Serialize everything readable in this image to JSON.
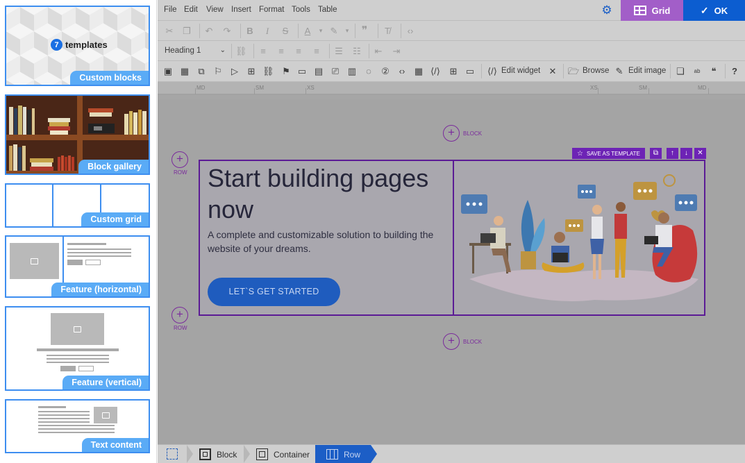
{
  "sidebar": {
    "templates": [
      {
        "label": "Custom blocks",
        "count": "7",
        "count_text": "templates"
      },
      {
        "label": "Block gallery"
      },
      {
        "label": "Custom grid"
      },
      {
        "label": "Feature (horizontal)"
      },
      {
        "label": "Feature (vertical)"
      },
      {
        "label": "Text content"
      }
    ]
  },
  "menubar": {
    "items": [
      "File",
      "Edit",
      "View",
      "Insert",
      "Format",
      "Tools",
      "Table"
    ],
    "grid_label": "Grid",
    "ok_label": "OK"
  },
  "toolbar": {
    "heading_value": "Heading 1",
    "edit_widget": "Edit widget",
    "browse": "Browse",
    "edit_image": "Edit image"
  },
  "ruler": {
    "labels": [
      "MD",
      "SM",
      "XS",
      "XS",
      "SM",
      "MD"
    ]
  },
  "canvas": {
    "add_block": "BLOCK",
    "add_row": "ROW",
    "save_as_template": "SAVE AS TEMPLATE",
    "hero": {
      "title": "Start building pages now",
      "subtitle": "A complete and customizable solution to building the website of your dreams.",
      "cta": "LET`S GET STARTED"
    }
  },
  "statusbar": {
    "crumbs": [
      "Block",
      "Container",
      "Row"
    ]
  },
  "colors": {
    "accent_purple": "#a25ec8",
    "primary_blue": "#0c5dd0",
    "row_outline": "#5b1b95",
    "template_blue": "#5aabf6"
  }
}
